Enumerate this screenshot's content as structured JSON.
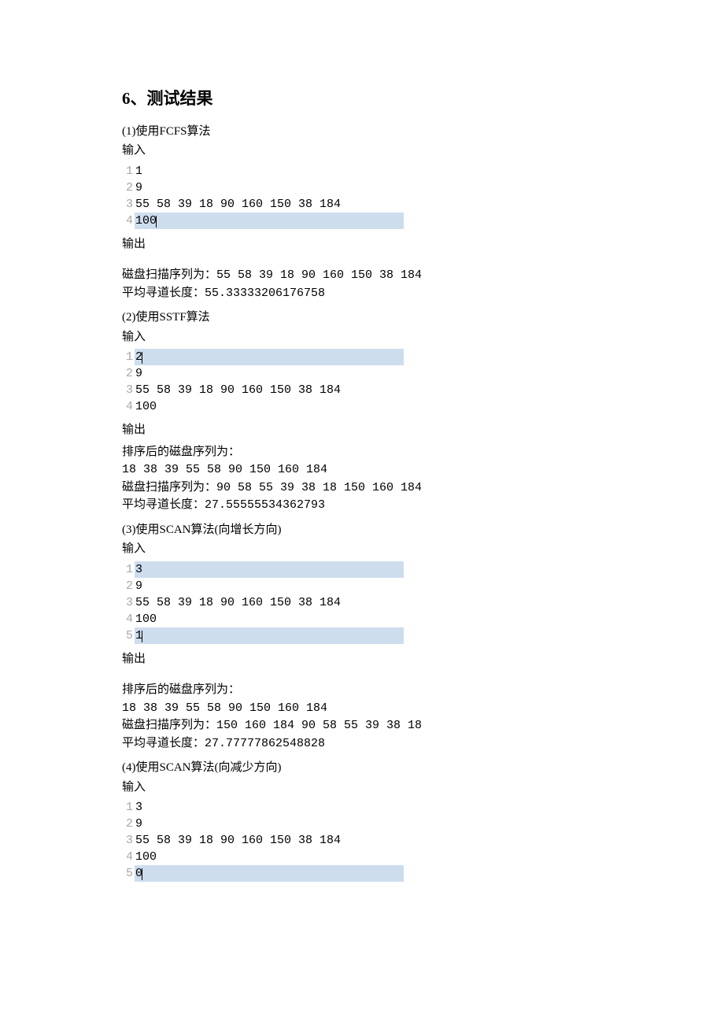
{
  "heading": "6、测试结果",
  "sections": [
    {
      "title": "(1)使用FCFS算法",
      "input_label": "输入",
      "input": [
        {
          "n": "1",
          "text": "1",
          "hl": false,
          "caret": false
        },
        {
          "n": "2",
          "text": "9",
          "hl": false,
          "caret": false
        },
        {
          "n": "3",
          "text": "55 58 39 18 90 160 150 38 184",
          "hl": false,
          "caret": false
        },
        {
          "n": "4",
          "text": "100",
          "hl": true,
          "caret": true
        }
      ],
      "output_label": "输出",
      "output_top_gap": true,
      "output": [
        "磁盘扫描序列为：55 58 39 18 90 160 150 38 184",
        "平均寻道长度：55.33333206176758"
      ]
    },
    {
      "title": "(2)使用SSTF算法",
      "input_label": "输入",
      "input": [
        {
          "n": "1",
          "text": "2",
          "hl": true,
          "caret": true
        },
        {
          "n": "2",
          "text": "9",
          "hl": false,
          "caret": false
        },
        {
          "n": "3",
          "text": "55 58 39 18 90 160 150 38 184",
          "hl": false,
          "caret": false
        },
        {
          "n": "4",
          "text": "100",
          "hl": false,
          "caret": false
        }
      ],
      "output_label": "输出",
      "output_top_gap": false,
      "output": [
        "排序后的磁盘序列为：",
        "18 38 39 55 58 90 150 160 184",
        "磁盘扫描序列为：90 58 55 39 38 18 150 160 184",
        "平均寻道长度：27.55555534362793"
      ]
    },
    {
      "title": "(3)使用SCAN算法(向增长方向)",
      "input_label": "输入",
      "input": [
        {
          "n": "1",
          "text": "3",
          "hl": true,
          "caret": false
        },
        {
          "n": "2",
          "text": "9",
          "hl": false,
          "caret": false
        },
        {
          "n": "3",
          "text": "55 58 39 18 90 160 150 38 184",
          "hl": false,
          "caret": false
        },
        {
          "n": "4",
          "text": "100",
          "hl": false,
          "caret": false
        },
        {
          "n": "5",
          "text": "1",
          "hl": true,
          "caret": true
        }
      ],
      "output_label": "输出",
      "output_top_gap": true,
      "output": [
        "排序后的磁盘序列为：",
        "18 38 39 55 58 90 150 160 184",
        "磁盘扫描序列为：150 160 184 90 58 55 39 38 18",
        "平均寻道长度：27.77777862548828"
      ]
    },
    {
      "title": "(4)使用SCAN算法(向减少方向)",
      "input_label": "输入",
      "input": [
        {
          "n": "1",
          "text": "3",
          "hl": false,
          "caret": false
        },
        {
          "n": "2",
          "text": "9",
          "hl": false,
          "caret": false
        },
        {
          "n": "3",
          "text": "55 58 39 18 90 160 150 38 184",
          "hl": false,
          "caret": false
        },
        {
          "n": "4",
          "text": "100",
          "hl": false,
          "caret": false
        },
        {
          "n": "5",
          "text": "0",
          "hl": true,
          "caret": true
        }
      ],
      "output_label": "",
      "output_top_gap": false,
      "output": []
    }
  ]
}
